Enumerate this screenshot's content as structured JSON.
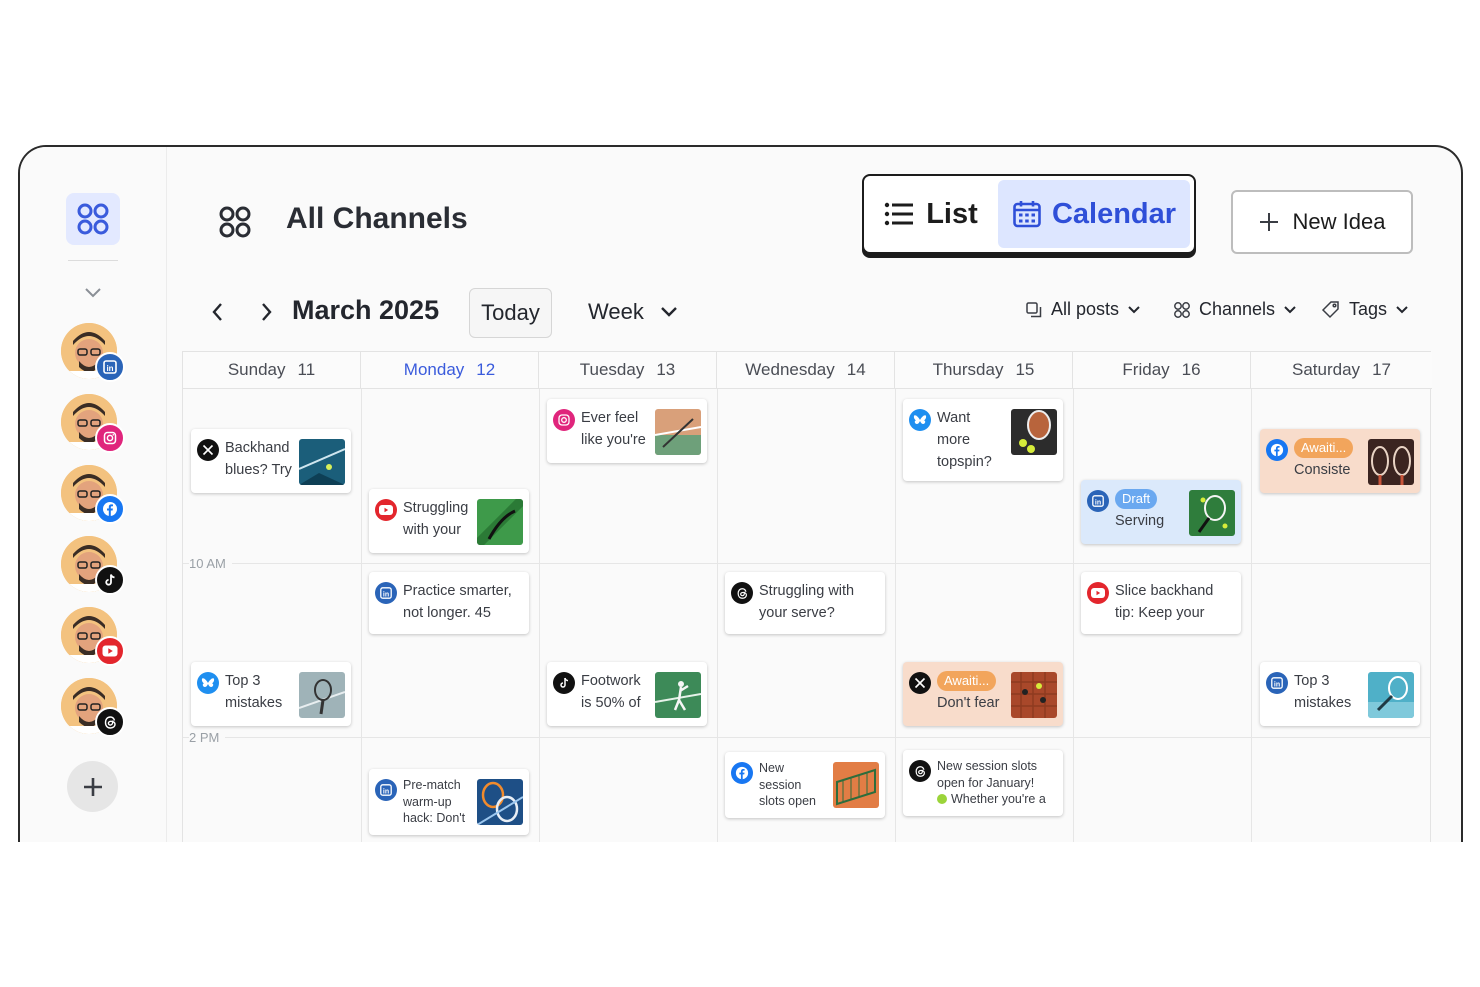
{
  "header": {
    "title": "All Channels",
    "view_list": "List",
    "view_calendar": "Calendar",
    "new_idea": "New Idea"
  },
  "toolbar": {
    "month": "March 2025",
    "today": "Today",
    "range": "Week",
    "filters": {
      "posts": "All posts",
      "channels": "Channels",
      "tags": "Tags"
    }
  },
  "sidebar": {
    "channels": [
      "linkedin",
      "instagram",
      "facebook",
      "tiktok",
      "youtube",
      "threads"
    ]
  },
  "calendar": {
    "days": [
      {
        "name": "Sunday",
        "num": "11"
      },
      {
        "name": "Monday",
        "num": "12"
      },
      {
        "name": "Tuesday",
        "num": "13"
      },
      {
        "name": "Wednesday",
        "num": "14"
      },
      {
        "name": "Thursday",
        "num": "15"
      },
      {
        "name": "Friday",
        "num": "16"
      },
      {
        "name": "Saturday",
        "num": "17"
      }
    ],
    "time_labels": [
      "10 AM",
      "2 PM"
    ],
    "posts": {
      "sun_a": {
        "l1": "Backhand",
        "l2": "blues? Try",
        "channel": "x"
      },
      "sun_b": {
        "l1": "Top 3",
        "l2": "mistakes",
        "channel": "bluesky"
      },
      "mon_a": {
        "l1": "Struggling",
        "l2": "with your",
        "channel": "youtube"
      },
      "mon_b": {
        "l1": "Practice smarter,",
        "l2": "not longer. 45",
        "channel": "linkedin"
      },
      "mon_c": {
        "l1": "Pre-match",
        "l2": "warm-up",
        "l3": "hack: Don't",
        "channel": "linkedin"
      },
      "tue_a": {
        "l1": "Ever feel",
        "l2": "like you're",
        "channel": "instagram"
      },
      "tue_b": {
        "l1": "Footwork",
        "l2": "is 50% of",
        "channel": "tiktok"
      },
      "wed_a": {
        "l1": "Struggling with",
        "l2": "your serve?",
        "channel": "threads"
      },
      "wed_b": {
        "l1": "New",
        "l2": "session",
        "l3": "slots open",
        "channel": "facebook"
      },
      "thu_a": {
        "l1": "Want more",
        "l2": "topspin?",
        "channel": "bluesky"
      },
      "thu_b": {
        "status": "Awaiti...",
        "l2": "Don't fear",
        "channel": "x"
      },
      "thu_c": {
        "l1": "New session slots",
        "l2": "open for January!",
        "l3": "Whether you're a",
        "channel": "threads"
      },
      "fri_a": {
        "status": "Draft",
        "l2": "Serving",
        "channel": "linkedin"
      },
      "fri_b": {
        "l1": "Slice backhand",
        "l2": "tip: Keep your",
        "channel": "youtube"
      },
      "sat_a": {
        "status": "Awaiti...",
        "l2": "Consiste",
        "channel": "facebook"
      },
      "sat_b": {
        "l1": "Top 3",
        "l2": "mistakes",
        "channel": "linkedin"
      }
    }
  },
  "colors": {
    "accent": "#3a5bdc",
    "linkedin": "#2a64b8",
    "instagram": "#e0257c",
    "facebook": "#1877f2",
    "youtube": "#e3262d",
    "bluesky": "#1f8ff0",
    "awaiting": "#f2a55c",
    "draft": "#6aa8f0"
  }
}
